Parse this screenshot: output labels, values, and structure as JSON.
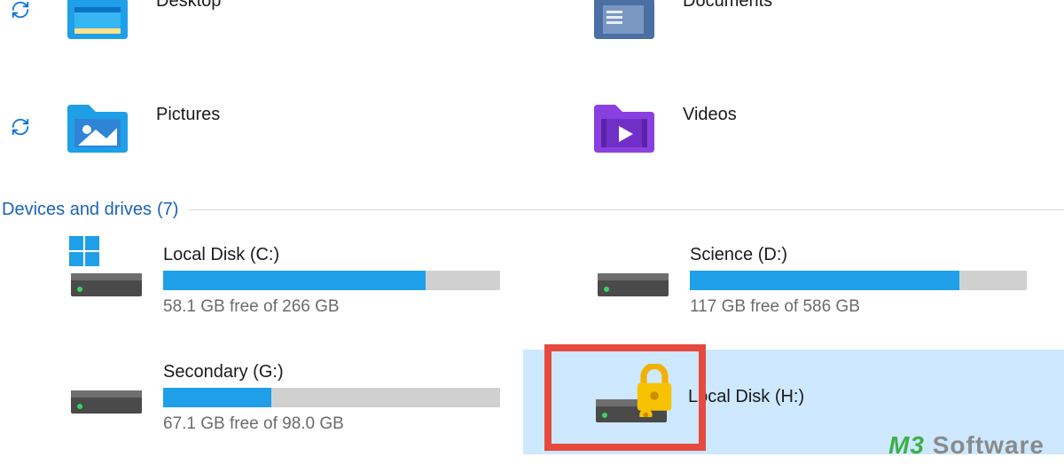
{
  "folders": [
    {
      "id": "desktop",
      "label": "Desktop",
      "icon": "desktop-folder-icon"
    },
    {
      "id": "documents",
      "label": "Documents",
      "icon": "documents-folder-icon"
    },
    {
      "id": "pictures",
      "label": "Pictures",
      "icon": "pictures-folder-icon"
    },
    {
      "id": "videos",
      "label": "Videos",
      "icon": "videos-folder-icon"
    }
  ],
  "section": {
    "title": "Devices and drives",
    "count_display": "(7)"
  },
  "drives": [
    {
      "id": "c",
      "name": "Local Disk (C:)",
      "free_text": "58.1 GB free of 266 GB",
      "fill_pct": 78,
      "has_os_badge": true
    },
    {
      "id": "d",
      "name": "Science (D:)",
      "free_text": "117 GB free of 586 GB",
      "fill_pct": 80
    },
    {
      "id": "g",
      "name": "Secondary (G:)",
      "free_text": "67.1 GB free of 98.0 GB",
      "fill_pct": 32
    },
    {
      "id": "h",
      "name": "Local Disk (H:)",
      "free_text": "",
      "locked": true,
      "selected": true,
      "no_bar": true
    }
  ],
  "watermark": {
    "brand_prefix": "M3",
    "brand_suffix": " Software"
  }
}
